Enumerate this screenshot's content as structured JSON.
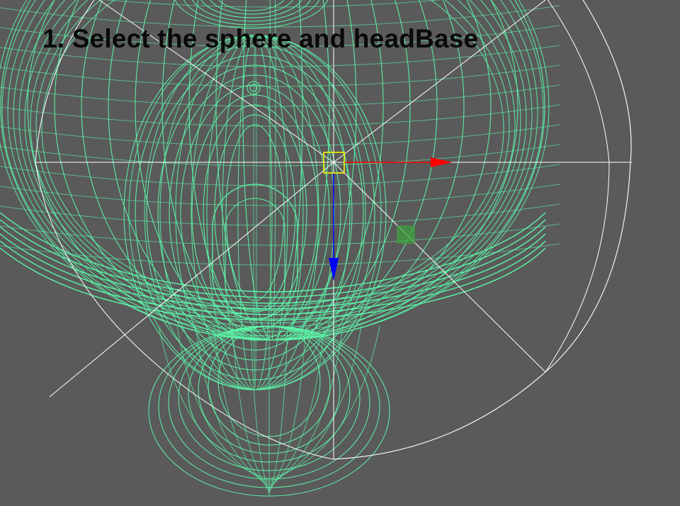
{
  "viewport": {
    "instruction": "1. Select the sphere and headBase",
    "background_color": "#5a5a5a",
    "wire_color": "#5cf5a8",
    "sphere_wire_color": "#ffffff"
  },
  "manipulator": {
    "x_axis_color": "#ff0000",
    "y_axis_color": "#0000ff",
    "center_color": "#ffff00",
    "plane_handle_color": "#3fa03f"
  }
}
